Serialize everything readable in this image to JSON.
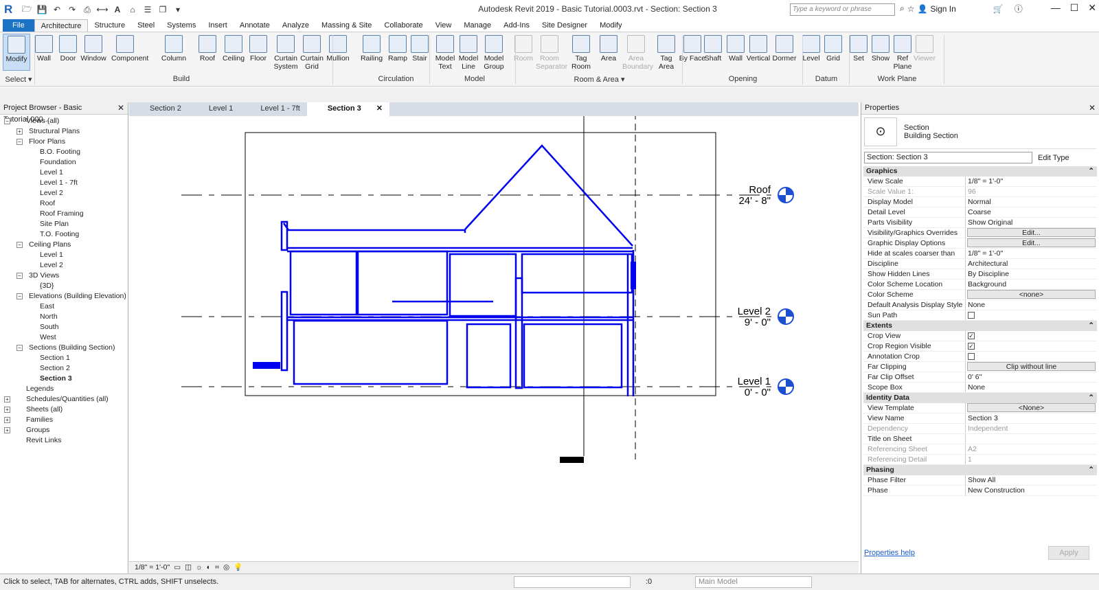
{
  "app": {
    "title": "Autodesk Revit 2019 - Basic Tutorial.0003.rvt - Section: Section 3",
    "search_placeholder": "Type a keyword or phrase",
    "sign_in": "Sign In"
  },
  "ribbon_tabs": [
    "File",
    "Architecture",
    "Structure",
    "Steel",
    "Systems",
    "Insert",
    "Annotate",
    "Analyze",
    "Massing & Site",
    "Collaborate",
    "View",
    "Manage",
    "Add-Ins",
    "Site Designer",
    "Modify"
  ],
  "ribbon_buttons": [
    {
      "label": "Modify",
      "sel": true
    },
    {
      "label": "Wall"
    },
    {
      "label": "Door"
    },
    {
      "label": "Window"
    },
    {
      "label": "Component"
    },
    {
      "label": "Column"
    },
    {
      "label": "Roof"
    },
    {
      "label": "Ceiling"
    },
    {
      "label": "Floor"
    },
    {
      "label": "Curtain System"
    },
    {
      "label": "Curtain Grid"
    },
    {
      "label": "Mullion"
    },
    {
      "label": "Railing"
    },
    {
      "label": "Ramp"
    },
    {
      "label": "Stair"
    },
    {
      "label": "Model Text"
    },
    {
      "label": "Model Line"
    },
    {
      "label": "Model Group"
    },
    {
      "label": "Room",
      "dis": true
    },
    {
      "label": "Room Separator",
      "dis": true
    },
    {
      "label": "Tag Room"
    },
    {
      "label": "Area"
    },
    {
      "label": "Area Boundary",
      "dis": true
    },
    {
      "label": "Tag Area"
    },
    {
      "label": "By Face"
    },
    {
      "label": "Shaft"
    },
    {
      "label": "Wall"
    },
    {
      "label": "Vertical"
    },
    {
      "label": "Dormer"
    },
    {
      "label": "Level"
    },
    {
      "label": "Grid"
    },
    {
      "label": "Set"
    },
    {
      "label": "Show"
    },
    {
      "label": "Ref Plane"
    },
    {
      "label": "Viewer",
      "dis": true
    }
  ],
  "ribbon_groups": [
    "Select ▾",
    "Build",
    "Circulation",
    "Model",
    "Room & Area ▾",
    "Opening",
    "Datum",
    "Work Plane"
  ],
  "browser": {
    "title": "Project Browser - Basic Tutorial.000...",
    "items": [
      {
        "t": "Views (all)",
        "l": 0,
        "e": "−"
      },
      {
        "t": "Structural Plans",
        "l": 1,
        "e": "+"
      },
      {
        "t": "Floor Plans",
        "l": 1,
        "e": "−"
      },
      {
        "t": "B.O. Footing",
        "l": 2
      },
      {
        "t": "Foundation",
        "l": 2
      },
      {
        "t": "Level 1",
        "l": 2
      },
      {
        "t": "Level 1 - 7ft",
        "l": 2
      },
      {
        "t": "Level 2",
        "l": 2
      },
      {
        "t": "Roof",
        "l": 2
      },
      {
        "t": "Roof Framing",
        "l": 2
      },
      {
        "t": "Site Plan",
        "l": 2
      },
      {
        "t": "T.O. Footing",
        "l": 2
      },
      {
        "t": "Ceiling Plans",
        "l": 1,
        "e": "−"
      },
      {
        "t": "Level 1",
        "l": 2
      },
      {
        "t": "Level 2",
        "l": 2
      },
      {
        "t": "3D Views",
        "l": 1,
        "e": "−"
      },
      {
        "t": "{3D}",
        "l": 2
      },
      {
        "t": "Elevations (Building Elevation)",
        "l": 1,
        "e": "−"
      },
      {
        "t": "East",
        "l": 2
      },
      {
        "t": "North",
        "l": 2
      },
      {
        "t": "South",
        "l": 2
      },
      {
        "t": "West",
        "l": 2
      },
      {
        "t": "Sections (Building Section)",
        "l": 1,
        "e": "−"
      },
      {
        "t": "Section 1",
        "l": 2
      },
      {
        "t": "Section 2",
        "l": 2
      },
      {
        "t": "Section 3",
        "l": 2,
        "b": true
      },
      {
        "t": "Legends",
        "l": 0
      },
      {
        "t": "Schedules/Quantities (all)",
        "l": 0,
        "e": "+"
      },
      {
        "t": "Sheets (all)",
        "l": 0,
        "e": "+"
      },
      {
        "t": "Families",
        "l": 0,
        "e": "+"
      },
      {
        "t": "Groups",
        "l": 0,
        "e": "+"
      },
      {
        "t": "Revit Links",
        "l": 0
      }
    ]
  },
  "view_tabs": [
    {
      "label": "Section 2"
    },
    {
      "label": "Level 1"
    },
    {
      "label": "Level 1 - 7ft"
    },
    {
      "label": "Section 3",
      "active": true
    }
  ],
  "levels": [
    {
      "name": "Roof",
      "elev": "24' - 8\""
    },
    {
      "name": "Level 2",
      "elev": "9' - 0\""
    },
    {
      "name": "Level 1",
      "elev": "0' - 0\""
    }
  ],
  "view_scale": "1/8\" = 1'-0\"",
  "properties": {
    "title": "Properties",
    "type_cat": "Section",
    "type_name": "Building Section",
    "instance": "Section: Section 3",
    "edit_type": "Edit Type",
    "help": "Properties help",
    "apply": "Apply",
    "sections": [
      {
        "name": "Graphics",
        "rows": [
          [
            "View Scale",
            "1/8\" = 1'-0\""
          ],
          [
            "Scale Value    1:",
            "96",
            "dim"
          ],
          [
            "Display Model",
            "Normal"
          ],
          [
            "Detail Level",
            "Coarse"
          ],
          [
            "Parts Visibility",
            "Show Original"
          ],
          [
            "Visibility/Graphics Overrides",
            "Edit...",
            "btn"
          ],
          [
            "Graphic Display Options",
            "Edit...",
            "btn"
          ],
          [
            "Hide at scales coarser than",
            "1/8\" = 1'-0\""
          ],
          [
            "Discipline",
            "Architectural"
          ],
          [
            "Show Hidden Lines",
            "By Discipline"
          ],
          [
            "Color Scheme Location",
            "Background"
          ],
          [
            "Color Scheme",
            "<none>",
            "btn"
          ],
          [
            "Default Analysis Display Style",
            "None"
          ],
          [
            "Sun Path",
            "",
            "chk0"
          ]
        ]
      },
      {
        "name": "Extents",
        "rows": [
          [
            "Crop View",
            "",
            "chk1"
          ],
          [
            "Crop Region Visible",
            "",
            "chk1"
          ],
          [
            "Annotation Crop",
            "",
            "chk0"
          ],
          [
            "Far Clipping",
            "Clip without line",
            "btn"
          ],
          [
            "Far Clip Offset",
            "0'  6\""
          ],
          [
            "Scope Box",
            "None"
          ]
        ]
      },
      {
        "name": "Identity Data",
        "rows": [
          [
            "View Template",
            "<None>",
            "btn"
          ],
          [
            "View Name",
            "Section 3"
          ],
          [
            "Dependency",
            "Independent",
            "dim"
          ],
          [
            "Title on Sheet",
            ""
          ],
          [
            "Referencing Sheet",
            "A2",
            "dim"
          ],
          [
            "Referencing Detail",
            "1",
            "dim"
          ]
        ]
      },
      {
        "name": "Phasing",
        "rows": [
          [
            "Phase Filter",
            "Show All"
          ],
          [
            "Phase",
            "New Construction"
          ]
        ]
      }
    ]
  },
  "status": {
    "text": "Click to select, TAB for alternates, CTRL adds, SHIFT unselects.",
    "zero": ":0",
    "main_model": "Main Model"
  }
}
